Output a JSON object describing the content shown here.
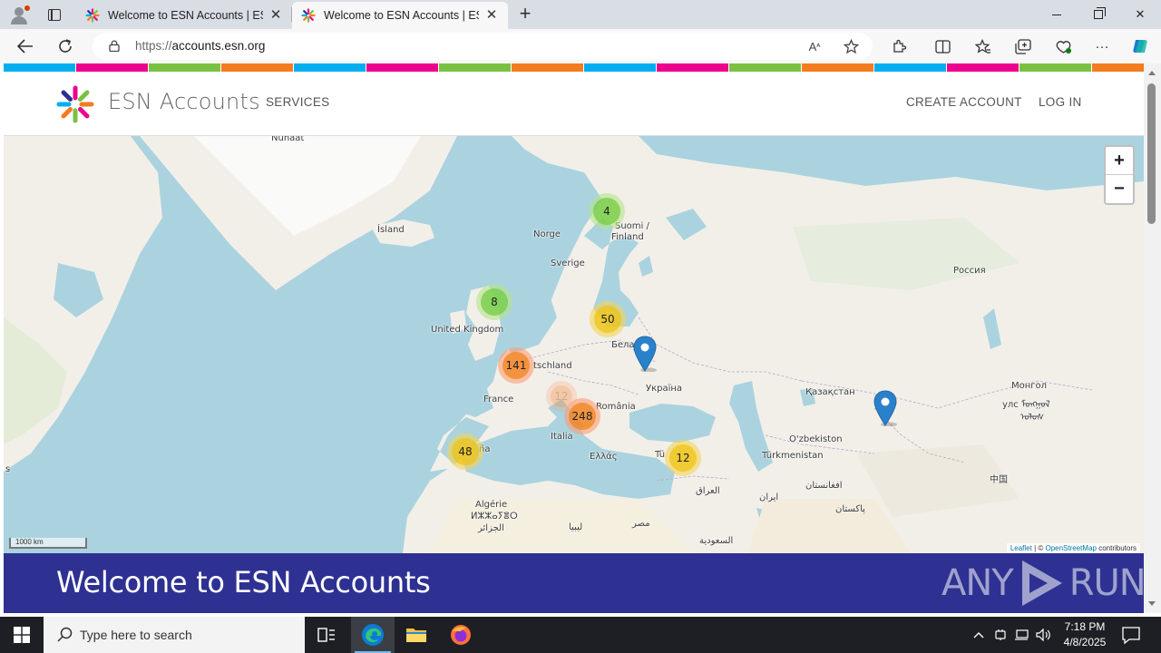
{
  "browser": {
    "tabs": [
      {
        "title": "Welcome to ESN Accounts | ESN",
        "active": false
      },
      {
        "title": "Welcome to ESN Accounts | ESN",
        "active": true
      }
    ],
    "url_scheme": "https://",
    "url_host": "accounts.esn.org"
  },
  "header": {
    "brand": "ESN Accounts",
    "nav_services": "SERVICES",
    "nav_create": "CREATE ACCOUNT",
    "nav_login": "LOG IN"
  },
  "colors": {
    "stripe": [
      "#00aeef",
      "#ec008c",
      "#7ac143",
      "#f47b20"
    ],
    "banner": "#2e3192"
  },
  "map": {
    "labels": {
      "nunaat": "Nunaat",
      "island": "Ísland",
      "norge": "Norge",
      "suomi": "Suomi /",
      "finland": "Finland",
      "sverige": "Sverige",
      "uk": "United Kingdom",
      "russia": "Россия",
      "belarus": "Белар",
      "deutschland": "tschland",
      "france": "France",
      "ukraine": "Україна",
      "romania": "România",
      "kazakhstan": "Қазақстан",
      "mongolia1": "Монгол",
      "mongolia2": "улс ᠮᠣᠩᠭᠣᠯ",
      "mongolia3": "ᠤᠯᠤᠰ",
      "italia": "Italia",
      "spain": "ña",
      "greece": "Ελλάς",
      "turkey": "Tü",
      "uzbekistan": "O'zbekiston",
      "turkmenistan": "Türkmenistan",
      "iraq": "العراق",
      "iran": "ایران",
      "afghanistan": "افغانستان",
      "pakistan": "پاکستان",
      "china": "中国",
      "algeria1": "Algérie",
      "algeria2": "ⵍⵣⵣⴰⵢⴻⵔ",
      "algeria3": "الجزائر",
      "libya": "ليبيا",
      "egypt": "مصر",
      "saudi": "السعودية",
      "edge_s": "s"
    },
    "clusters": {
      "finland": "4",
      "uk": "8",
      "baltic": "50",
      "germany": "141",
      "balkans": "248",
      "spain": "48",
      "turkey": "12",
      "ghost": "12"
    },
    "scale": "1000 km",
    "attribution_leaflet": "Leaflet",
    "attribution_sep": " | © ",
    "attribution_osm": "OpenStreetMap",
    "attribution_tail": " contributors",
    "zoom_in": "+",
    "zoom_out": "−"
  },
  "banner": {
    "title": "Welcome to ESN Accounts",
    "watermark_left": "ANY",
    "watermark_right": "RUN"
  },
  "taskbar": {
    "search_placeholder": "Type here to search",
    "time": "7:18 PM",
    "date": "4/8/2025"
  }
}
